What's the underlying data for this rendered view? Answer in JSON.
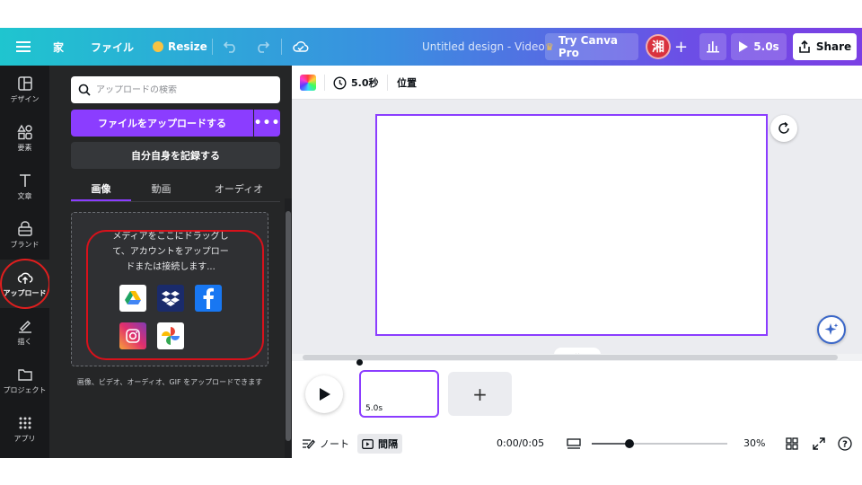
{
  "topbar": {
    "home": "家",
    "file": "ファイル",
    "resize": "Resize",
    "title": "Untitled design - Video",
    "try_pro": "Try Canva Pro",
    "avatar_char": "湘",
    "play_duration": "5.0s",
    "share": "Share"
  },
  "rail": {
    "items": [
      {
        "label": "デザイン",
        "icon": "layout-icon"
      },
      {
        "label": "要素",
        "icon": "shapes-icon"
      },
      {
        "label": "文章",
        "icon": "text-icon"
      },
      {
        "label": "ブランド",
        "icon": "brand-icon"
      },
      {
        "label": "アップロード",
        "icon": "upload-cloud-icon"
      },
      {
        "label": "描く",
        "icon": "draw-icon"
      },
      {
        "label": "プロジェクト",
        "icon": "folder-icon"
      },
      {
        "label": "アプリ",
        "icon": "apps-grid-icon"
      }
    ]
  },
  "panel": {
    "search_placeholder": "アップロードの検索",
    "upload_button": "ファイルをアップロードする",
    "record_button": "自分自身を記録する",
    "tabs": [
      "画像",
      "動画",
      "オーディオ"
    ],
    "drop_line1": "メディアをここにドラッグし",
    "drop_line2": "て、アカウントをアップロー",
    "drop_line3": "ドまたは接続します...",
    "drop_note": "画像、ビデオ、オーディオ、GIF をアップロードできます",
    "apps": [
      "google-drive-icon",
      "dropbox-icon",
      "facebook-icon",
      "instagram-icon",
      "google-photos-icon"
    ]
  },
  "toolbar": {
    "duration": "5.0秒",
    "position": "位置"
  },
  "timeline": {
    "clip_duration": "5.0s",
    "add": "+"
  },
  "bottom": {
    "notes": "ノート",
    "interval": "間隔",
    "time": "0:00/0:05",
    "zoom": "30%",
    "zoom_level": 0.28
  },
  "colors": {
    "accent": "#8b3dff",
    "dark_panel": "#252627",
    "rail": "#18191b",
    "highlight": "#d8111b"
  }
}
